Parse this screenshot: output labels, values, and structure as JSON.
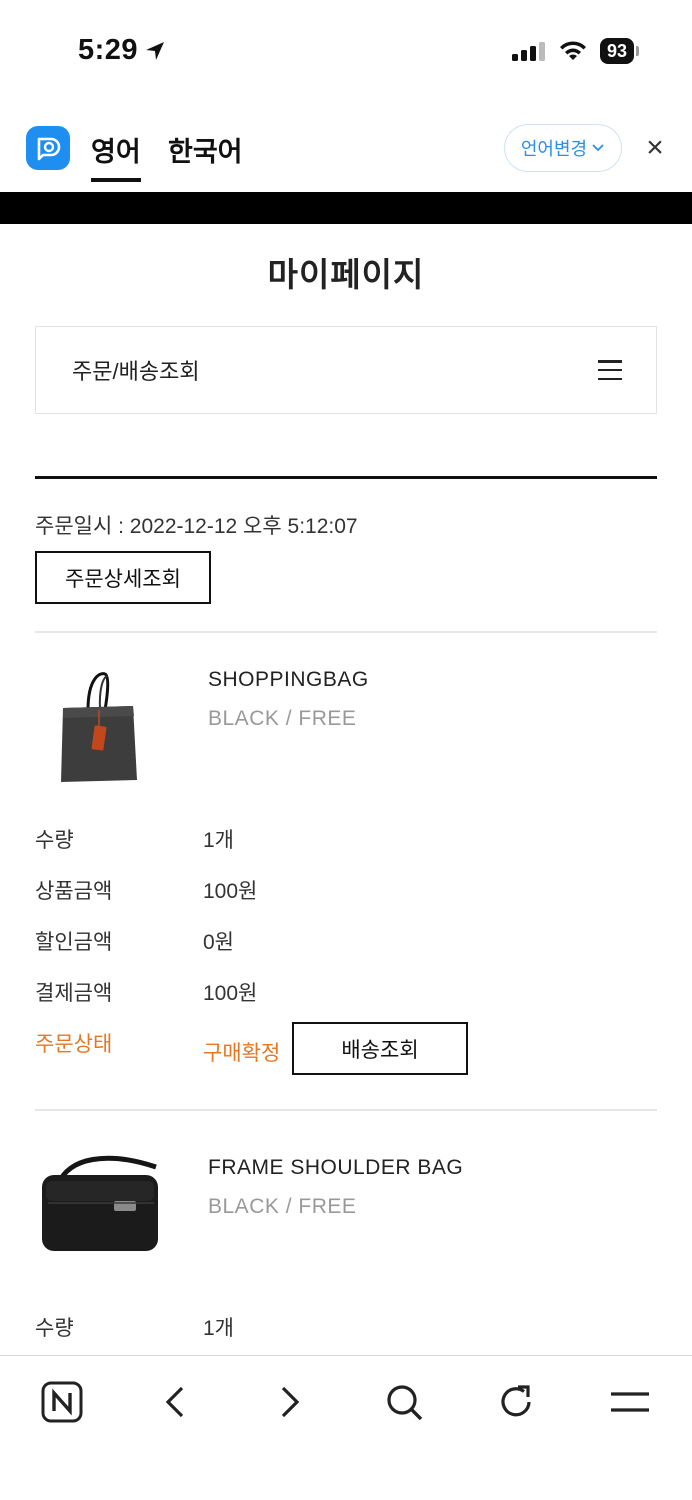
{
  "status_bar": {
    "time": "5:29",
    "battery": "93"
  },
  "translate_bar": {
    "tabs": [
      {
        "label": "영어",
        "active": true
      },
      {
        "label": "한국어",
        "active": false
      }
    ],
    "change_button": "언어변경",
    "close_label": "×"
  },
  "page": {
    "title": "마이페이지",
    "menu_select": "주문/배송조회"
  },
  "order": {
    "date_line": "주문일시 : 2022-12-12 오후 5:12:07",
    "detail_button": "주문상세조회",
    "items": [
      {
        "name": "SHOPPINGBAG",
        "option": "BLACK / FREE",
        "rows": [
          {
            "label": "수량",
            "value": "1개"
          },
          {
            "label": "상품금액",
            "value": "100원"
          },
          {
            "label": "할인금액",
            "value": "0원"
          },
          {
            "label": "결제금액",
            "value": "100원"
          }
        ],
        "status_label": "주문상태",
        "status_value": "구매확정",
        "delivery_button": "배송조회"
      },
      {
        "name": "FRAME SHOULDER BAG",
        "option": "BLACK / FREE",
        "rows": [
          {
            "label": "수량",
            "value": "1개"
          }
        ]
      }
    ]
  },
  "colors": {
    "accent": "#e87722",
    "link_blue": "#2c8ee8",
    "logo_blue": "#1e8ff0"
  },
  "toolbar": {
    "icons": [
      "naver-n-icon",
      "back-arrow-icon",
      "forward-arrow-icon",
      "search-icon",
      "refresh-icon",
      "menu-icon"
    ]
  }
}
